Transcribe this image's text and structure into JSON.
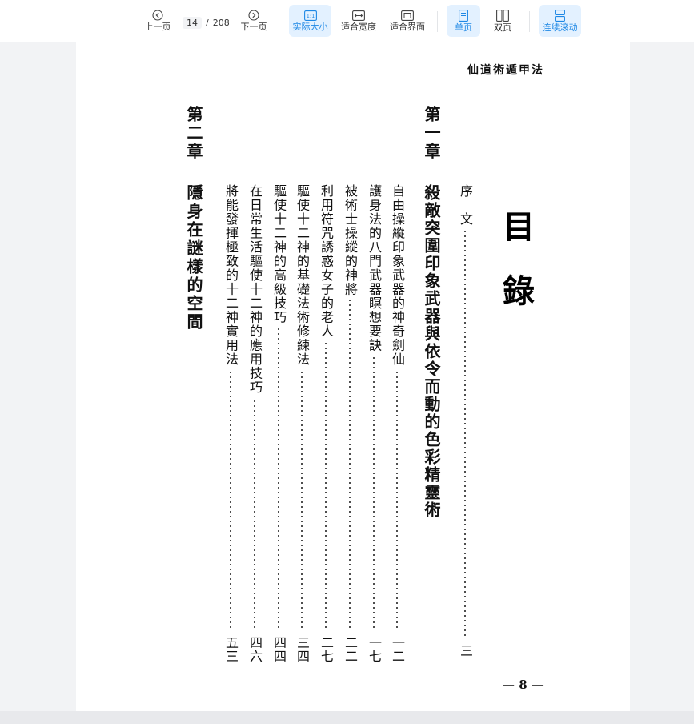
{
  "toolbar": {
    "prev_label": "上一页",
    "next_label": "下一页",
    "current_page": "14",
    "page_separator": "/",
    "total_pages": "208",
    "actual_size_label": "实际大小",
    "actual_size_icon_text": "1:1",
    "fit_width_label": "适合宽度",
    "fit_page_label": "适合界面",
    "single_page_label": "单页",
    "double_page_label": "双页",
    "continuous_scroll_label": "连续滚动",
    "active_color": "#1e88e5",
    "active_bg": "#e3f1ff",
    "icons": {
      "prev": "chevron-left-circle-icon",
      "next": "chevron-right-circle-icon",
      "actual_size": "actual-size-icon",
      "fit_width": "fit-width-icon",
      "fit_page": "fit-page-icon",
      "single_page": "single-page-icon",
      "double_page": "double-page-icon",
      "continuous_scroll": "continuous-scroll-icon"
    }
  },
  "document": {
    "header": "仙道術遁甲法",
    "contents_title": "目錄",
    "preface": {
      "label": "序　文",
      "page": "三"
    },
    "chapters": [
      {
        "label": "第一章",
        "title": "殺敵突圍印象武器與依令而動的色彩精靈術",
        "entries": [
          {
            "title": "自由操縱印象武器的神奇劍仙",
            "page": "一二"
          },
          {
            "title": "護身法的八門武器瞑想要訣",
            "page": "一七"
          },
          {
            "title": "被術士操縱的神將",
            "page": "二二"
          },
          {
            "title": "利用符咒誘惑女子的老人",
            "page": "二七"
          },
          {
            "title": "驅使十二神的基礎法術修練法",
            "page": "三四"
          },
          {
            "title": "驅使十二神的高級技巧",
            "page": "四四"
          },
          {
            "title": "在日常生活驅使十二神的應用技巧",
            "page": "四六"
          },
          {
            "title": "將能發揮極致的十二神實用法",
            "page": "五三"
          }
        ]
      },
      {
        "label": "第二章",
        "title": "隱身在謎樣的空間"
      }
    ],
    "footer": "— 8 —"
  }
}
